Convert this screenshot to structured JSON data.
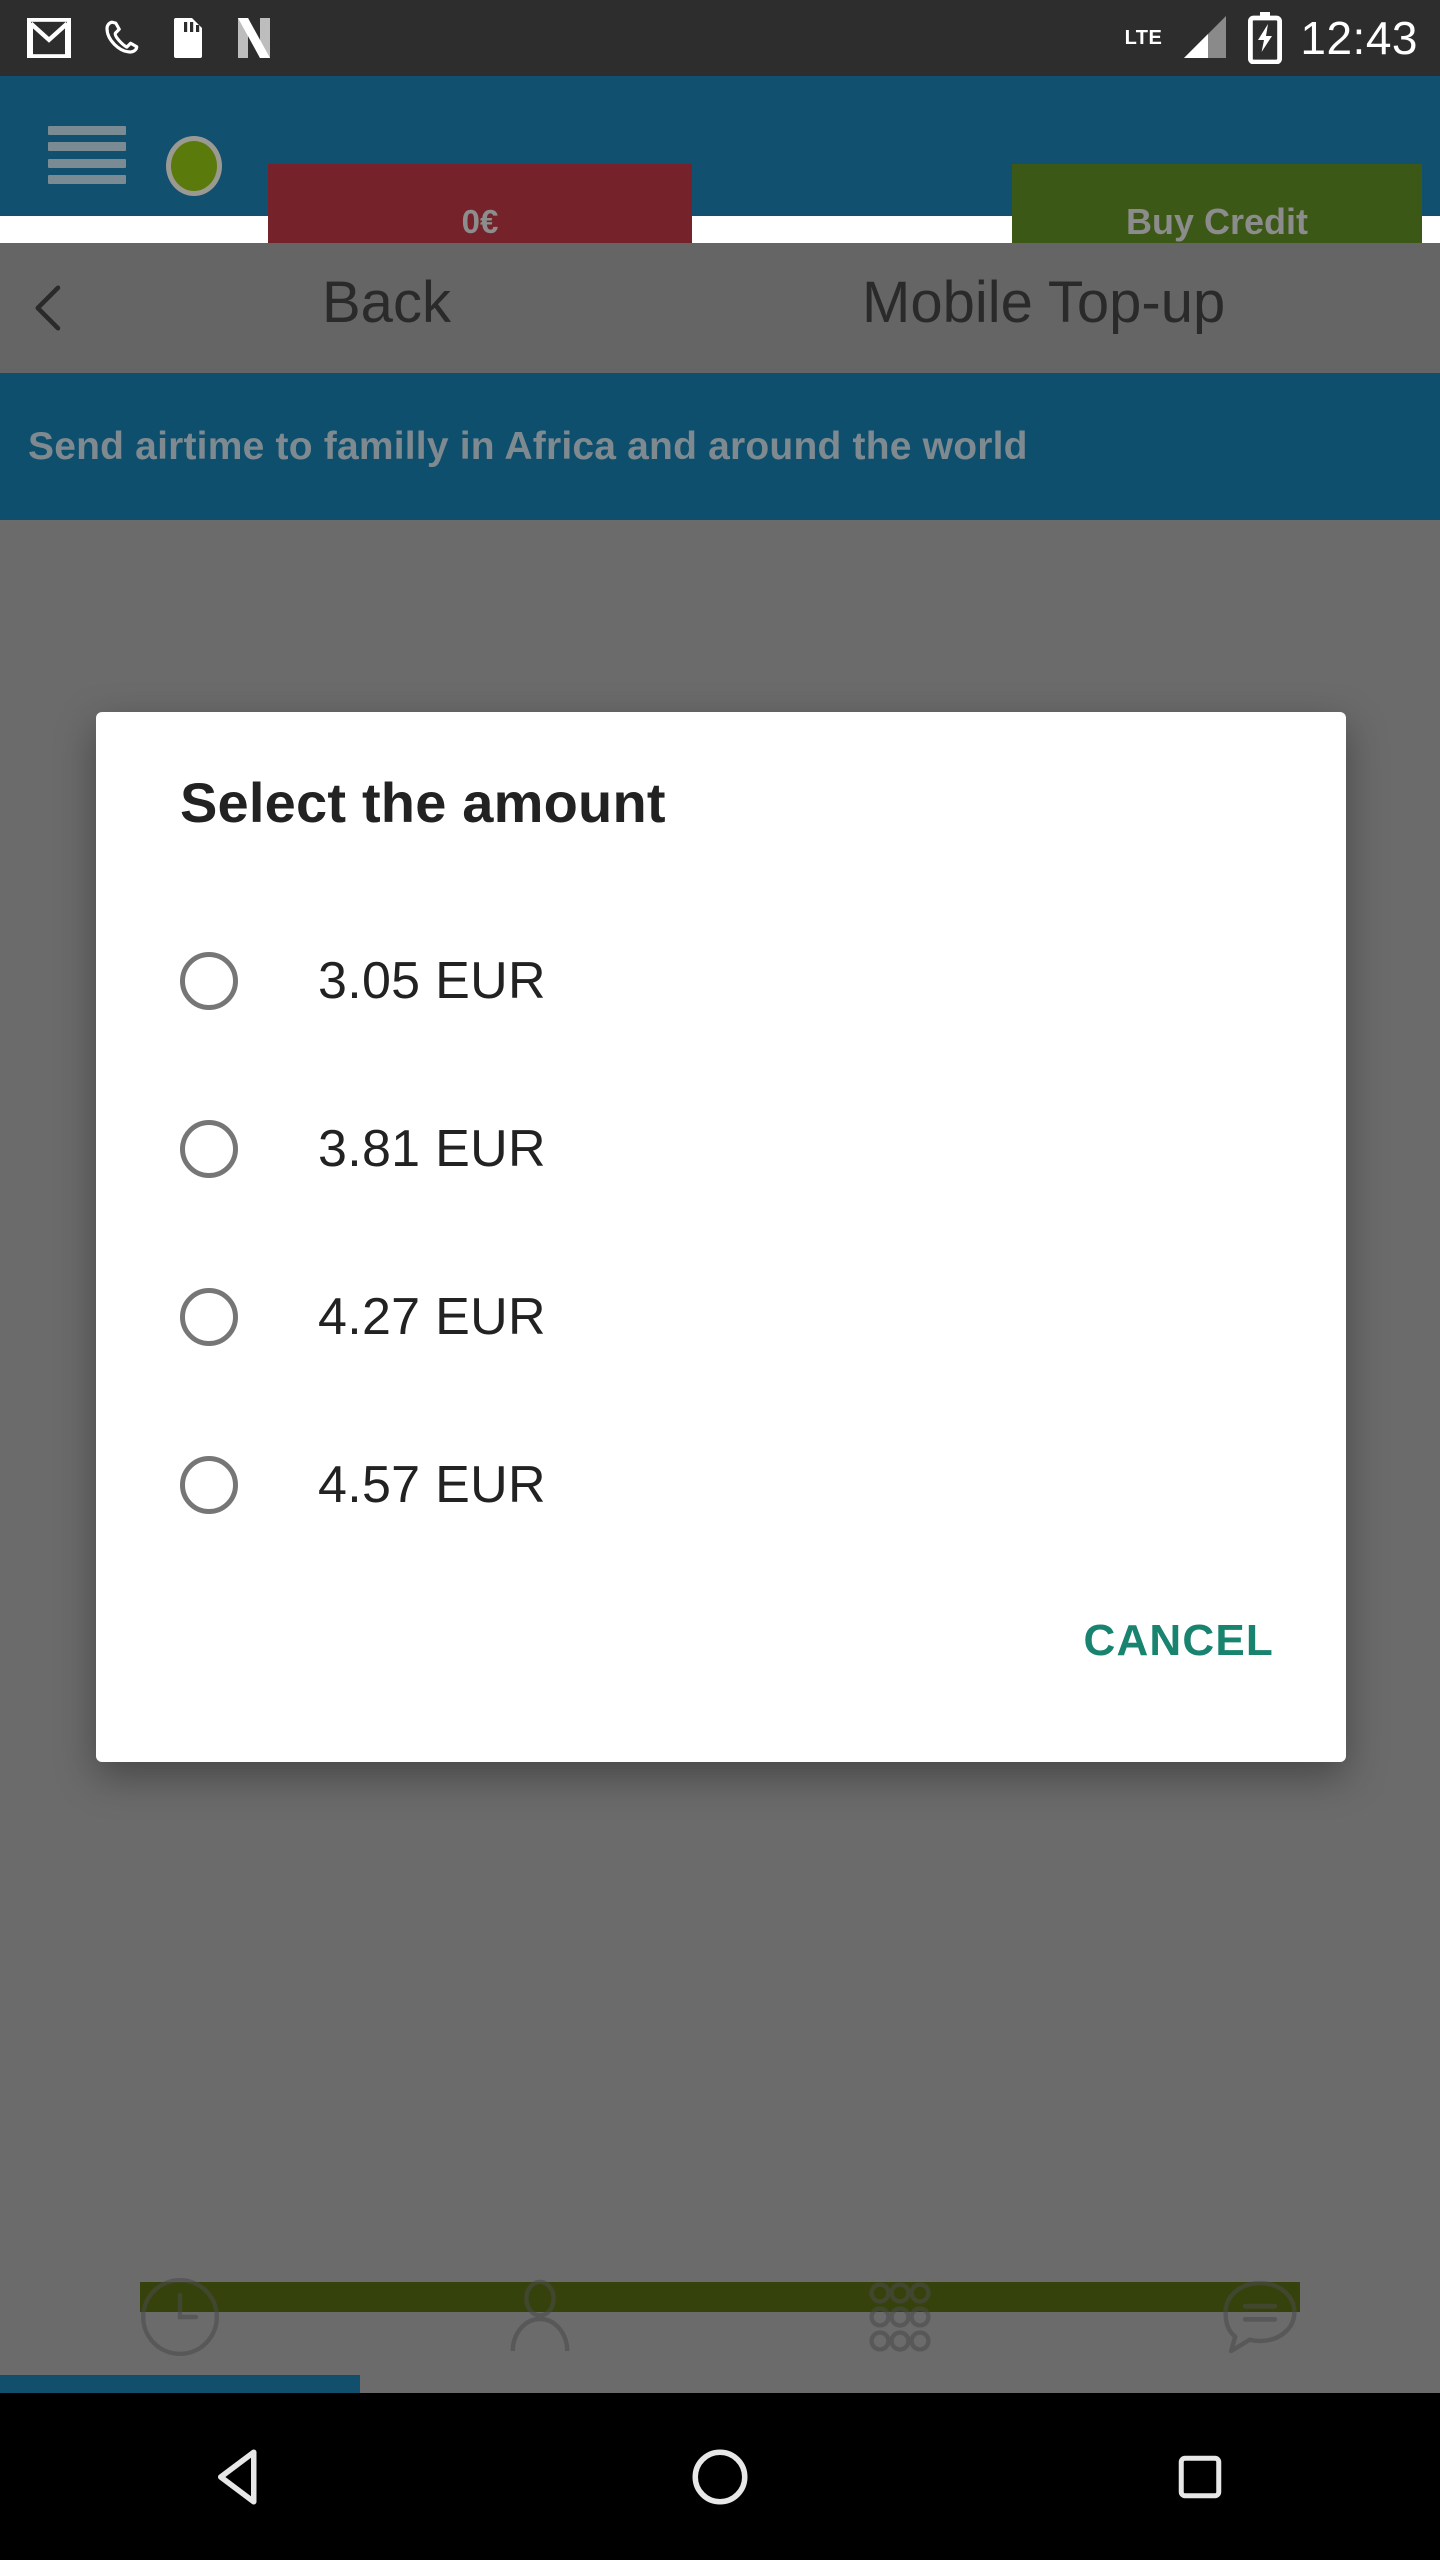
{
  "status_bar": {
    "icons": [
      "gmail-icon",
      "phone-call-icon",
      "sim-card-icon",
      "netflix-icon"
    ],
    "network_label": "LTE",
    "signal_icon": "signal-bars-icon",
    "battery_icon": "battery-charging-icon",
    "time": "12:43"
  },
  "app_bar": {
    "menu_icon": "hamburger-menu-icon",
    "status_dot": "account-status-dot",
    "balance_label": "0€",
    "buy_credit_label": "Buy Credit",
    "background_color": "#11506e",
    "balance_color": "#76222a",
    "buy_credit_color": "#3b5817"
  },
  "nav_row": {
    "back_icon": "chevron-left-icon",
    "back_label": "Back",
    "page_title": "Mobile Top-up"
  },
  "banner": {
    "text": "Send airtime to familly in Africa and around the world",
    "background_color": "#0f4f6e"
  },
  "dialog": {
    "title": "Select the amount",
    "options": [
      {
        "label": "3.05 EUR",
        "selected": false
      },
      {
        "label": "3.81 EUR",
        "selected": false
      },
      {
        "label": "4.27 EUR",
        "selected": false
      },
      {
        "label": "4.57 EUR",
        "selected": false
      }
    ],
    "cancel_label": "CANCEL",
    "accent_color": "#18836e"
  },
  "tab_bar": {
    "tabs": [
      {
        "icon": "history-clock-icon",
        "active": true
      },
      {
        "icon": "contacts-person-icon",
        "active": false
      },
      {
        "icon": "dialpad-icon",
        "active": false
      },
      {
        "icon": "chat-bubble-icon",
        "active": false
      }
    ],
    "indicator_color": "#124f6d"
  },
  "system_nav": {
    "back_icon": "android-back-icon",
    "home_icon": "android-home-icon",
    "recents_icon": "android-recents-icon"
  }
}
